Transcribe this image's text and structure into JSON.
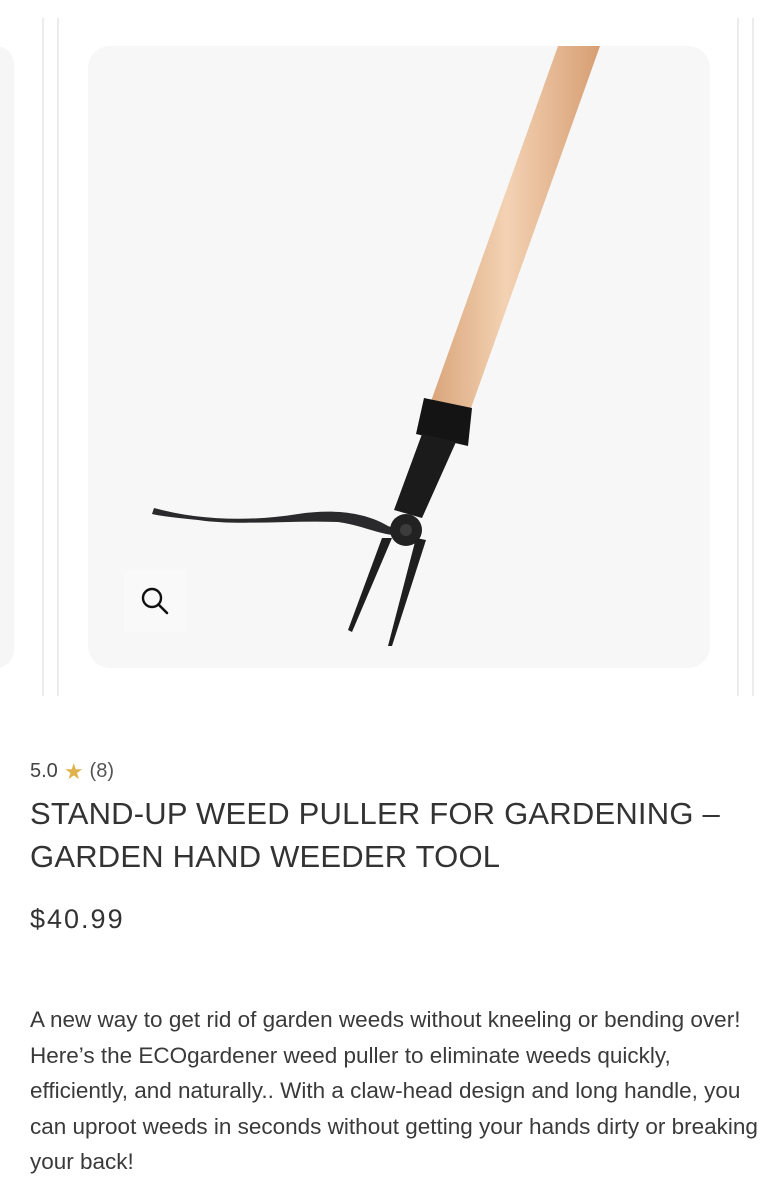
{
  "gallery": {
    "image_alt": "Stand-up weed puller with wooden handle and claw head",
    "zoom_icon": "magnifier-icon"
  },
  "product": {
    "rating_value": "5.0",
    "rating_star": "★",
    "rating_count": "(8)",
    "title": "STAND-UP WEED PULLER FOR GARDENING – GARDEN HAND WEEDER TOOL",
    "price": "$40.99",
    "description": "A new way to get rid of garden weeds without kneeling or bending over! Here’s the ECOgardener weed puller to eliminate weeds quickly, efficiently, and naturally.. With a claw-head design and long handle, you can uproot weeds in seconds without getting your hands dirty or breaking your back!"
  },
  "colors": {
    "star": "#e0b24c",
    "text": "#333333",
    "image_bg": "#f7f7f7"
  }
}
